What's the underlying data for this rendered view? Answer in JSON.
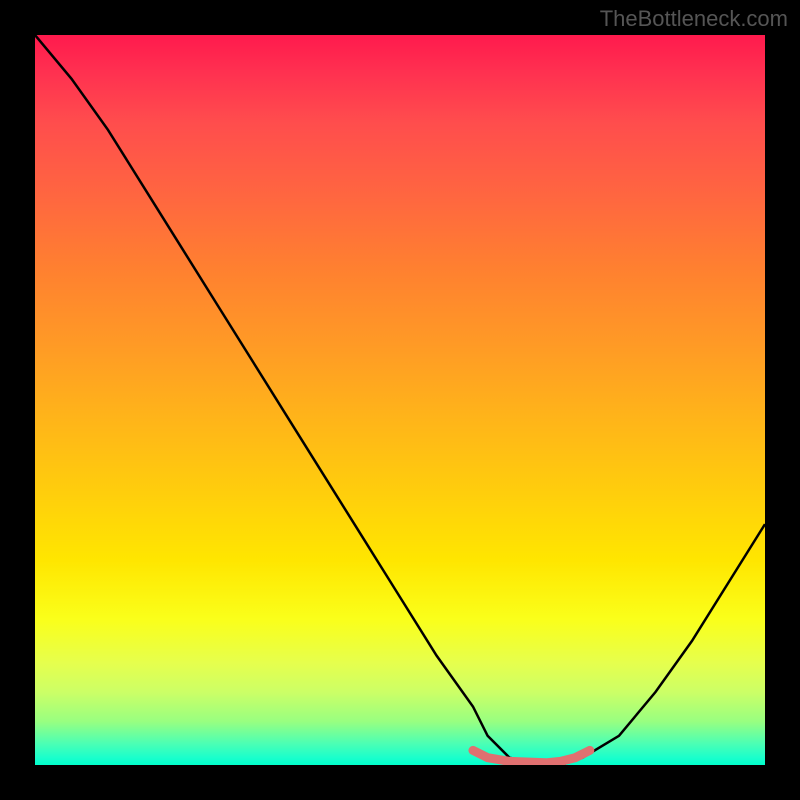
{
  "watermark": "TheBottleneck.com",
  "chart_data": {
    "type": "line",
    "title": "",
    "xlabel": "",
    "ylabel": "",
    "xlim": [
      0,
      100
    ],
    "ylim": [
      0,
      100
    ],
    "series": [
      {
        "name": "bottleneck-curve",
        "x": [
          0,
          5,
          10,
          15,
          20,
          25,
          30,
          35,
          40,
          45,
          50,
          55,
          60,
          62,
          65,
          70,
          72,
          75,
          80,
          85,
          90,
          95,
          100
        ],
        "y": [
          100,
          94,
          87,
          79,
          71,
          63,
          55,
          47,
          39,
          31,
          23,
          15,
          8,
          4,
          1,
          0,
          0,
          1,
          4,
          10,
          17,
          25,
          33
        ]
      },
      {
        "name": "flat-zone-highlight",
        "x": [
          60,
          62,
          65,
          70,
          72,
          74,
          76
        ],
        "y": [
          2,
          1,
          0.5,
          0.3,
          0.5,
          1,
          2
        ]
      }
    ],
    "gradient_colors": {
      "top": "#ff1a4d",
      "mid_upper": "#ff8030",
      "mid": "#ffe600",
      "mid_lower": "#ccff66",
      "bottom": "#00ffcc"
    },
    "highlight_color": "#e07070"
  }
}
